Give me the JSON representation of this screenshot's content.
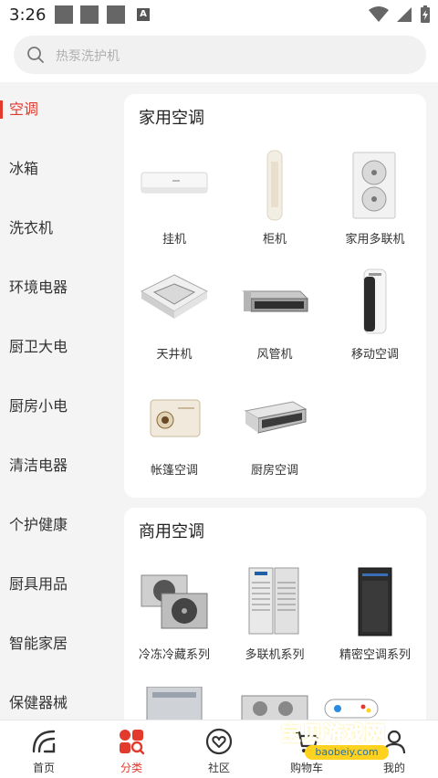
{
  "status_bar": {
    "time": "3:26",
    "badge": "A"
  },
  "search": {
    "placeholder": "热泵洗护机"
  },
  "sidebar": {
    "items": [
      {
        "label": "空调",
        "active": true
      },
      {
        "label": "冰箱"
      },
      {
        "label": "洗衣机"
      },
      {
        "label": "环境电器"
      },
      {
        "label": "厨卫大电"
      },
      {
        "label": "厨房小电"
      },
      {
        "label": "清洁电器"
      },
      {
        "label": "个护健康"
      },
      {
        "label": "厨具用品"
      },
      {
        "label": "智能家居"
      },
      {
        "label": "保健器械"
      }
    ]
  },
  "sections": [
    {
      "title": "家用空调",
      "items": [
        {
          "label": "挂机",
          "icon": "wall-ac"
        },
        {
          "label": "柜机",
          "icon": "floor-ac"
        },
        {
          "label": "家用多联机",
          "icon": "outdoor-unit"
        },
        {
          "label": "天井机",
          "icon": "cassette-ac"
        },
        {
          "label": "风管机",
          "icon": "duct-ac"
        },
        {
          "label": "移动空调",
          "icon": "portable-ac"
        },
        {
          "label": "帐篷空调",
          "icon": "tent-ac"
        },
        {
          "label": "厨房空调",
          "icon": "kitchen-ac"
        }
      ]
    },
    {
      "title": "商用空调",
      "items": [
        {
          "label": "冷冻冷藏系列",
          "icon": "condensing-unit"
        },
        {
          "label": "多联机系列",
          "icon": "vrf-unit"
        },
        {
          "label": "精密空调系列",
          "icon": "precision-ac"
        }
      ]
    }
  ],
  "bottom_nav": [
    {
      "label": "首页",
      "icon": "home-icon"
    },
    {
      "label": "分类",
      "icon": "category-icon",
      "active": true
    },
    {
      "label": "社区",
      "icon": "community-icon"
    },
    {
      "label": "购物车",
      "icon": "cart-icon"
    },
    {
      "label": "我的",
      "icon": "profile-icon"
    }
  ],
  "watermark": {
    "text": "宝贝游戏网",
    "url": "baobeiy.com"
  },
  "colors": {
    "accent": "#e33a2e",
    "background": "#f4f4f4"
  }
}
